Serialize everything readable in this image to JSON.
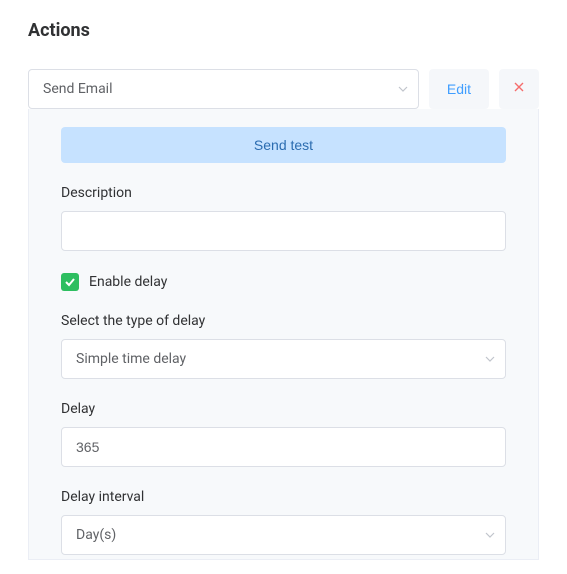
{
  "section": {
    "title": "Actions"
  },
  "action": {
    "type_selected": "Send Email",
    "edit_label": "Edit"
  },
  "body": {
    "send_test_label": "Send test",
    "description_label": "Description",
    "description_value": "",
    "enable_delay_label": "Enable delay",
    "enable_delay_checked": true,
    "delay_type_label": "Select the type of delay",
    "delay_type_selected": "Simple time delay",
    "delay_label": "Delay",
    "delay_value": "365",
    "delay_interval_label": "Delay interval",
    "delay_interval_selected": "Day(s)"
  }
}
